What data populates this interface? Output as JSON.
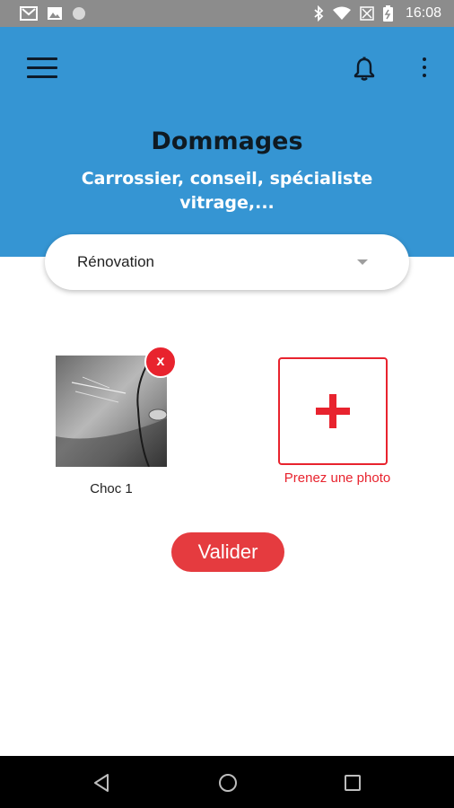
{
  "status_bar": {
    "time": "16:08",
    "icons_left": [
      "gmail-icon",
      "image-icon",
      "circle-icon"
    ],
    "icons_right": [
      "bluetooth-icon",
      "wifi-icon",
      "no-signal-icon",
      "battery-icon"
    ]
  },
  "header": {
    "background": "#3595d3",
    "title": "Dommages",
    "subtitle": "Carrossier, conseil, spécialiste vitrage,..."
  },
  "dropdown": {
    "selected_value": "Rénovation"
  },
  "photos": [
    {
      "label": "Choc 1",
      "remove_label": "x"
    }
  ],
  "add_photo": {
    "label": "Prenez une photo",
    "accent": "#e8232e"
  },
  "actions": {
    "validate_label": "Valider",
    "validate_color": "#e53b3f"
  },
  "nav_bar": {
    "buttons": [
      "back-icon",
      "home-icon",
      "recents-icon"
    ]
  }
}
